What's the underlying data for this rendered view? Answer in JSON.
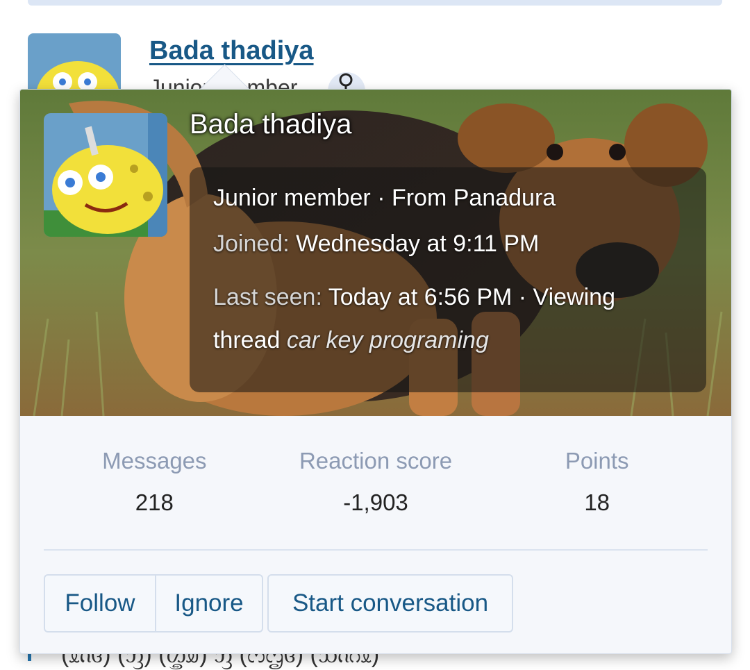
{
  "background": {
    "username": "Bada thadiya",
    "subtext": "Junior member",
    "bottom_text": "(ᦸᦵᦑ) (ᦀ) (ᦄᦾ) ᦀ (ᦂᦗᦑ) (ᦉᦵᦅᦸ)"
  },
  "popup": {
    "username": "Bada thadiya",
    "info": {
      "title_line": "Junior member · From Panadura",
      "joined_label": "Joined:",
      "joined_value": "Wednesday at 9:11 PM",
      "last_seen_label": "Last seen:",
      "last_seen_value": "Today at 6:56 PM · Viewing",
      "activity_prefix": "thread",
      "activity_thread": "car key programing"
    },
    "stats": [
      {
        "label": "Messages",
        "value": "218"
      },
      {
        "label": "Reaction score",
        "value": "-1,903"
      },
      {
        "label": "Points",
        "value": "18"
      }
    ],
    "buttons": {
      "follow": "Follow",
      "ignore": "Ignore",
      "start_conversation": "Start conversation"
    }
  },
  "colors": {
    "link": "#185886",
    "muted_label": "#8c9ab3",
    "popup_bg": "#f5f7fb"
  },
  "icons": {
    "search": "search-icon"
  }
}
